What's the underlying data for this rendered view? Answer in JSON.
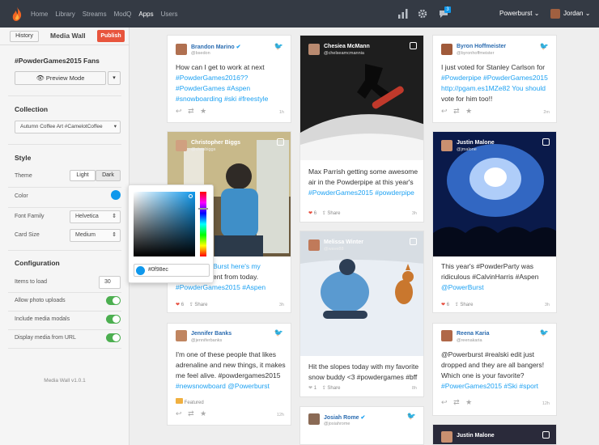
{
  "topbar": {
    "nav": [
      "Home",
      "Library",
      "Streams",
      "ModQ",
      "Apps",
      "Users"
    ],
    "active_nav": "Apps",
    "badge": "3",
    "account": "Powerburst",
    "user": "Jordan"
  },
  "sidebar": {
    "history_label": "History",
    "title": "Media Wall",
    "publish_label": "Publish",
    "wall_name": "#PowderGames2015 Fans",
    "preview_label": "Preview Mode",
    "collection_heading": "Collection",
    "collection_value": "Autumn Coffee Art #CamelotCoffee",
    "style_heading": "Style",
    "theme_label": "Theme",
    "theme_light": "Light",
    "theme_dark": "Dark",
    "color_label": "Color",
    "color_value": "#0f98ec",
    "font_label": "Font Family",
    "font_value": "Helvetica",
    "cardsize_label": "Card Size",
    "cardsize_value": "Medium",
    "config_heading": "Configuration",
    "items_label": "Items to load",
    "items_value": "30",
    "allow_uploads_label": "Allow photo uploads",
    "media_modals_label": "Include media modals",
    "display_url_label": "Display media from URL",
    "version": "Media Wall v1.0.1"
  },
  "cards": {
    "c1": {
      "name": "Brandon Marino",
      "handle": "@bsedon",
      "text": [
        "How can I get to work at next",
        "#PowderGames2016??",
        "#PowderGames #Aspen",
        "#snowboarding #ski #freestyle"
      ],
      "time": "1h"
    },
    "c2": {
      "name": "Christopher Biggs",
      "handle": "@chrisbiggs",
      "text": [
        "Burst here's my",
        "ent from today.",
        "#PowderGames2015 #Aspen"
      ],
      "likes": "6",
      "share": "Share",
      "time": "3h"
    },
    "c3": {
      "name": "Jennifer Banks",
      "handle": "@jenniferbanks",
      "text": [
        "I'm one of these people that likes",
        "adrenaline and new things, it makes",
        "me feel alive. #powdergames2015",
        "#newsnowboard @Powerburst"
      ],
      "featured": "Featured",
      "time": "12h"
    },
    "c4": {
      "name": "Chesiea McMann",
      "handle": "@chelseamcmannia",
      "text": [
        "Max Parrish getting some awesome",
        "air in the Powderpipe at this year's",
        "#PowderGames2015 #powderpipe"
      ],
      "likes": "6",
      "share": "Share",
      "time": "3h"
    },
    "c5": {
      "name": "Melissa Winter",
      "handle": "@wave88",
      "text": [
        "Hit the slopes today with my favorite",
        "snow buddy <3 #powdergames #bff"
      ],
      "likes": "1",
      "share": "Share",
      "time": "8h"
    },
    "c6": {
      "name": "Josiah Rome",
      "handle": "@josiahrome"
    },
    "c7": {
      "name": "Byron Hoffmeister",
      "handle": "@byronhoffmeister",
      "text": [
        "I just voted for Stanley Carlson for",
        "#Powderpipe #PowderGames2015",
        "http://pgam.es1MZe82 You should",
        "vote for him too!!"
      ],
      "time": "2m"
    },
    "c8": {
      "name": "Justin Malone",
      "handle": "@jmalone",
      "text": [
        "This year's #PowderParty was",
        "ridiculous #CalvinHarris #Aspen",
        "@PowerBurst"
      ],
      "likes": "6",
      "share": "Share",
      "time": "3h"
    },
    "c9": {
      "name": "Reena Karia",
      "handle": "@reenakaria",
      "text": [
        "@Powerburst #realski edit just",
        "dropped and they are all bangers!",
        "Which one is your favorite?",
        "#PowerGames2015 #Ski #sport"
      ],
      "time": "12h"
    },
    "c10": {
      "name": "Justin Malone"
    }
  },
  "colors": {
    "accent": "#0f98ec",
    "publish": "#e8553d",
    "twitter": "#1da1f2",
    "toggle": "#4caf50",
    "topbar": "#343a44"
  }
}
